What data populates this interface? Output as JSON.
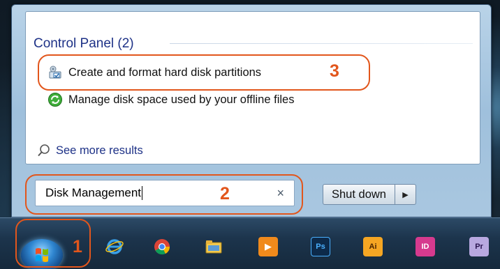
{
  "results": {
    "section_title": "Control Panel (2)",
    "items": [
      {
        "label": "Create and format hard disk partitions",
        "icon": "disk-partition-icon"
      },
      {
        "label": "Manage disk space used by your offline files",
        "icon": "offline-files-icon"
      }
    ],
    "see_more": "See more results"
  },
  "search": {
    "value": "Disk Management",
    "clear_icon": "×"
  },
  "power": {
    "shutdown_label": "Shut down",
    "arrow_icon": "▶"
  },
  "taskbar": {
    "icons": [
      {
        "name": "internet-explorer-icon",
        "glyph": "e",
        "bg": "transparent",
        "fg": "#3aa0e8"
      },
      {
        "name": "chrome-icon",
        "glyph": "",
        "bg": "transparent",
        "fg": "#fff"
      },
      {
        "name": "file-explorer-icon",
        "glyph": "",
        "bg": "transparent",
        "fg": "#fff"
      },
      {
        "name": "media-player-icon",
        "glyph": "▶",
        "bg": "#f08a1c",
        "fg": "#fff"
      },
      {
        "name": "photoshop-icon",
        "glyph": "Ps",
        "bg": "#0d2a4a",
        "fg": "#4ab0ff"
      },
      {
        "name": "illustrator-icon",
        "glyph": "Ai",
        "bg": "#f5a623",
        "fg": "#4a2400"
      },
      {
        "name": "indesign-icon",
        "glyph": "ID",
        "bg": "#d63a8e",
        "fg": "#fff"
      },
      {
        "name": "premiere-icon",
        "glyph": "Pr",
        "bg": "#b8a8e0",
        "fg": "#2a1450"
      }
    ]
  },
  "annotations": [
    "1",
    "2",
    "3"
  ],
  "colors": {
    "annotation": "#e2561c",
    "section_title": "#1e3287"
  }
}
